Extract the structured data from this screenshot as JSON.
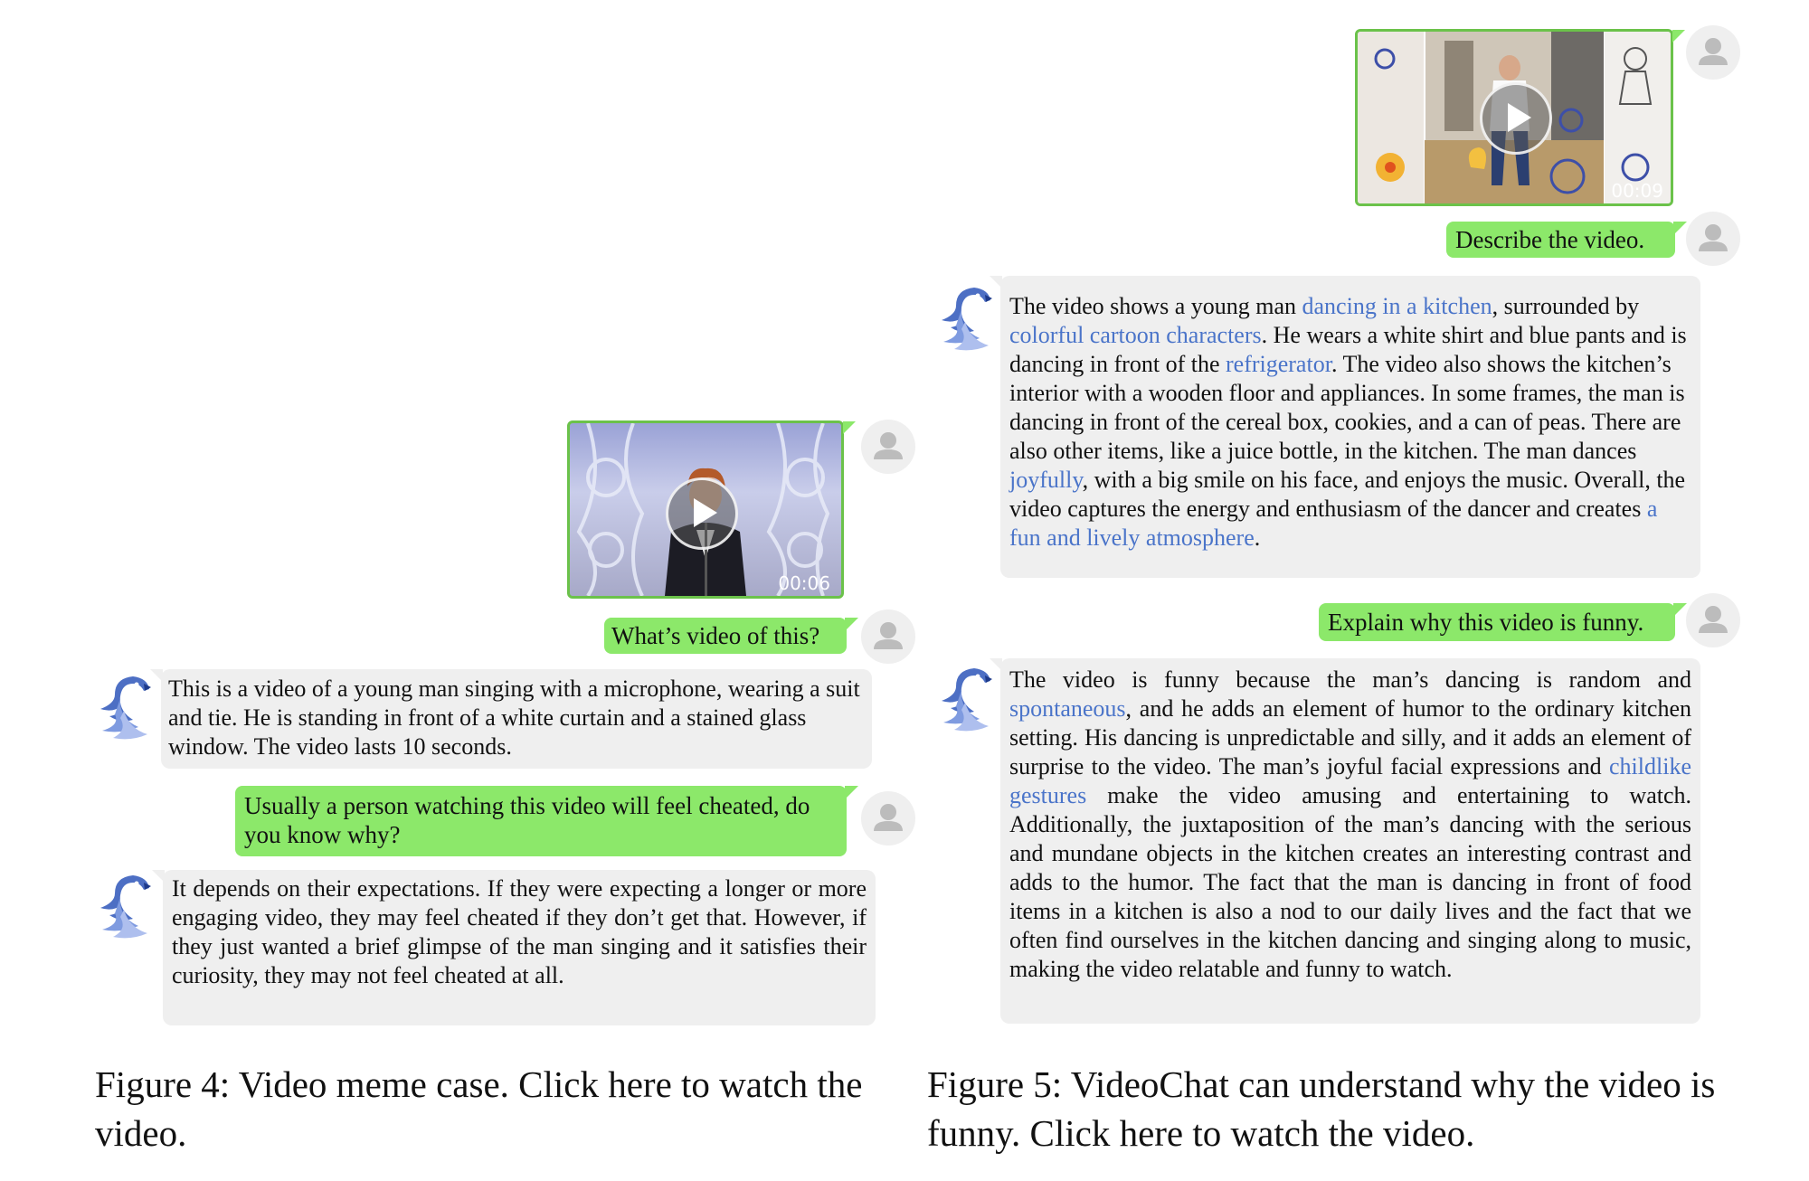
{
  "left_panel": {
    "video": {
      "duration": "00:06"
    },
    "user_q1": "What’s video of this?",
    "bot_a1": "This is a video of a young man singing with a microphone, wearing a suit and tie. He is standing in front of a white curtain and a stained glass window. The video lasts 10 seconds.",
    "user_q2": "Usually a person watching this video will feel cheated, do you know why?",
    "bot_a2": "It depends on their expectations. If they were expecting a longer or more engaging video, they may feel cheated if they don’t get that. However, if they just wanted a brief glimpse of the man singing and it satisfies their curiosity, they may not feel cheated at all."
  },
  "right_panel": {
    "video": {
      "duration": "00:09"
    },
    "user_q1": "Describe the video.",
    "bot_a1": {
      "t1": "The video shows a young man ",
      "h1": "dancing in a kitchen",
      "t2": ", surrounded by ",
      "h2": "colorful cartoon characters",
      "t3": ". He wears a white shirt and blue pants and is dancing in front of the ",
      "h3": "refrigerator",
      "t4": ". The video also shows the kitchen’s interior with a wooden floor and appliances. In some frames, the man is dancing in front of the cereal box, cookies, and a can of peas. There are also other items, like a juice bottle, in the kitchen. The man dances ",
      "h4": "joyfully",
      "t5": ", with a big smile on his face, and enjoys the music. Overall, the video captures the energy and enthusiasm of the dancer and creates ",
      "h5": "a fun and lively atmosphere",
      "t6": "."
    },
    "user_q2": "Explain why this video is funny.",
    "bot_a2": {
      "t1": "The video is funny because the man’s dancing is random and ",
      "h1": "spontaneous",
      "t2": ", and he adds an element of humor to the ordinary kitchen setting. His dancing is unpredictable and silly, and it adds an element of surprise to the video. The man’s joyful facial expressions and ",
      "h2": "childlike gestures",
      "t3": " make the video amusing and entertaining to watch. Additionally, the juxtaposition of the man’s dancing with the serious and mundane objects in the kitchen creates an interesting contrast and adds to the humor. The fact that the man is dancing in front of food items in a kitchen is also a nod to our daily lives and the fact that we often find ourselves in the kitchen dancing and singing along to music, making the video relatable and funny to watch."
    }
  },
  "captions": {
    "fig4": "Figure 4: Video meme case. Click here to watch the video.",
    "fig5": "Figure 5: VideoChat can understand why the video is funny. Click here to watch the video."
  },
  "colors": {
    "user_bubble": "#8ce86a",
    "bot_bubble": "#efefef",
    "highlight": "#4a74c9",
    "video_border": "#6bc24a"
  },
  "icons": {
    "user": "user-silhouette-icon",
    "bot": "parrot-bot-icon",
    "play": "play-icon"
  }
}
